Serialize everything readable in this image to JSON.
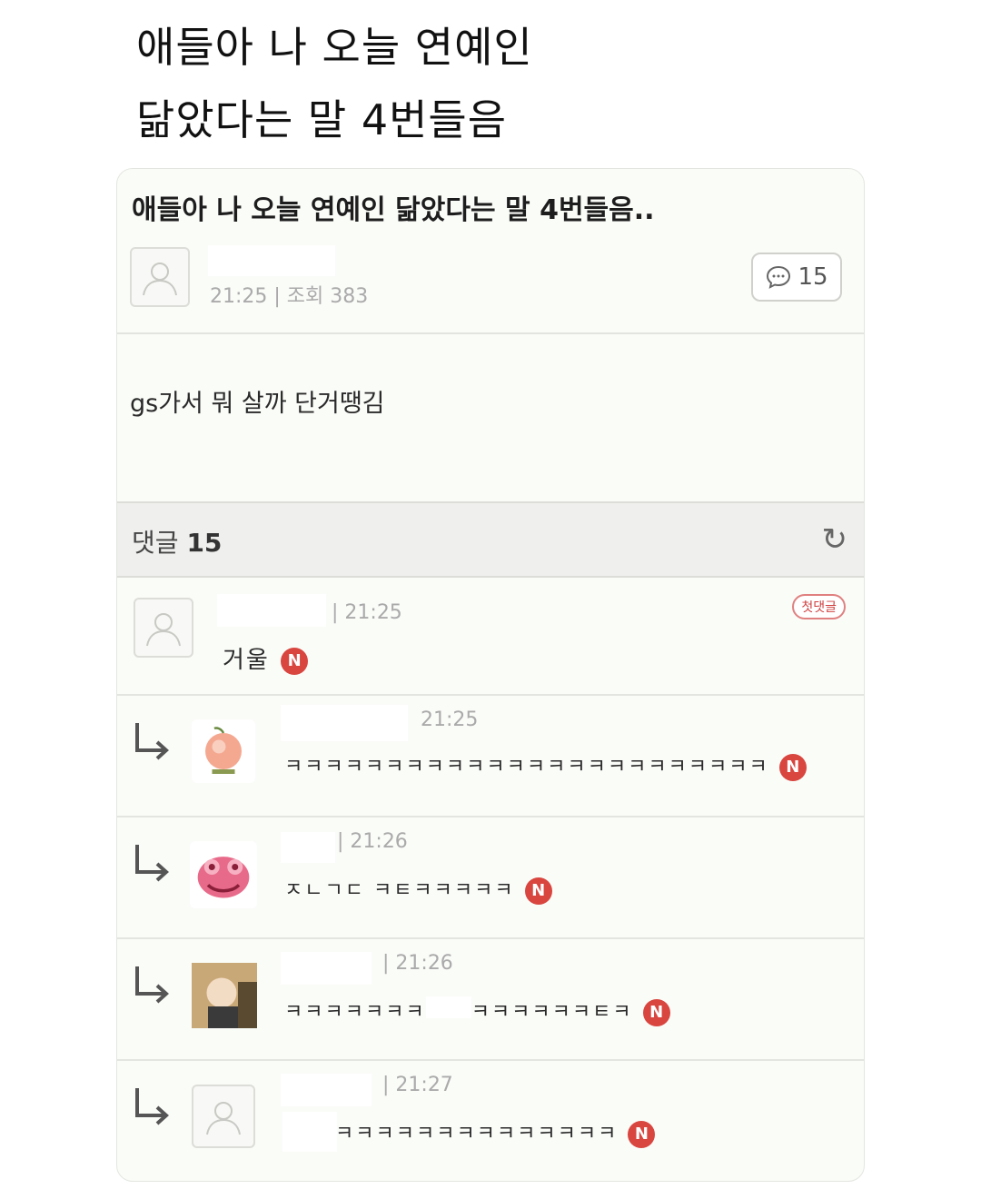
{
  "caption": {
    "line1": "애들아 나 오늘 연예인",
    "line2": "닮았다는 말 4번들음"
  },
  "post": {
    "title": "애들아 나 오늘 연예인 닮았다는 말 4번들음..",
    "time_views": "21:25 | 조회 383",
    "comment_count": "15",
    "body": "gs가서 뭐 살까 단거땡김"
  },
  "comments_header": {
    "label": "댓글",
    "count": "15"
  },
  "comments": [
    {
      "time": "21:25",
      "text": "거울",
      "badge": "N",
      "first_badge": "첫댓글"
    },
    {
      "time": "21:25",
      "text": "ㅋㅋㅋㅋㅋㅋㅋㅋㅋㅋㅋㅋㅋㅋㅋㅋㅋㅋㅋㅋㅋㅋㅋㅋ",
      "badge": "N"
    },
    {
      "time": "21:26",
      "text": "ㅈㄴㄱㄷ ㅋㅌㅋㅋㅋㅋㅋ",
      "badge": "N"
    },
    {
      "time": "21:26",
      "text_a": "ㅋㅋㅋㅋㅋㅋㅋ",
      "text_b": "ㅋㅋㅋㅋㅋㅋㅌㅋ",
      "badge": "N"
    },
    {
      "time": "21:27",
      "text": "ㅋㅋㅋㅋㅋㅋㅋㅋㅋㅋㅋㅋㅋㅋ",
      "badge": "N"
    }
  ],
  "icons": {
    "avatar": "default-user-icon",
    "reply": "reply-arrow-icon",
    "comment": "speech-bubble-icon",
    "refresh": "refresh-icon"
  },
  "colors": {
    "badge_red": "#d9453f"
  }
}
